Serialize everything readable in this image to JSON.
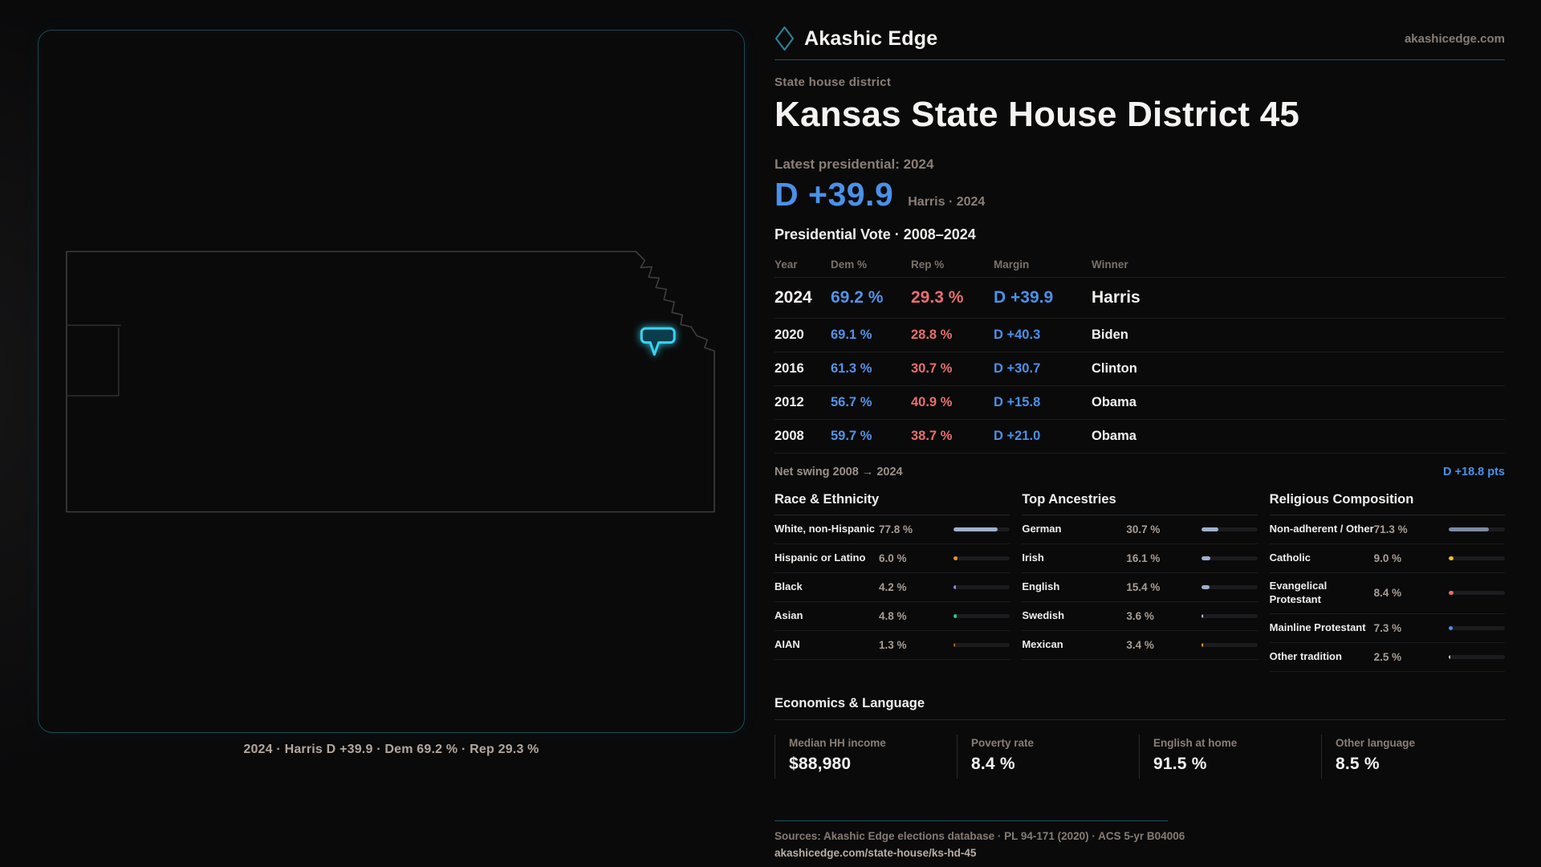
{
  "brand": {
    "name": "Akashic Edge",
    "site": "akashicedge.com"
  },
  "page": {
    "eyebrow": "State house district",
    "title": "Kansas State House District 45"
  },
  "latest": {
    "label": "Latest presidential: 2024",
    "margin": "D +39.9",
    "context": "Harris · 2024"
  },
  "vote_table": {
    "title": "Presidential Vote · 2008–2024",
    "columns": [
      "Year",
      "Dem %",
      "Rep %",
      "Margin",
      "Winner"
    ],
    "rows": [
      {
        "year": "2024",
        "dem": "69.2 %",
        "rep": "29.3 %",
        "margin": "D +39.9",
        "winner": "Harris"
      },
      {
        "year": "2020",
        "dem": "69.1 %",
        "rep": "28.8 %",
        "margin": "D +40.3",
        "winner": "Biden"
      },
      {
        "year": "2016",
        "dem": "61.3 %",
        "rep": "30.7 %",
        "margin": "D +30.7",
        "winner": "Clinton"
      },
      {
        "year": "2012",
        "dem": "56.7 %",
        "rep": "40.9 %",
        "margin": "D +15.8",
        "winner": "Obama"
      },
      {
        "year": "2008",
        "dem": "59.7 %",
        "rep": "38.7 %",
        "margin": "D +21.0",
        "winner": "Obama"
      }
    ]
  },
  "net_swing": {
    "label": "Net swing 2008 → 2024",
    "value": "D +18.8 pts"
  },
  "sections": [
    {
      "title": "Race & Ethnicity",
      "rows": [
        {
          "label": "White, non-Hispanic",
          "value": "77.8 %",
          "pct": 77.8,
          "color": "#9db1cc"
        },
        {
          "label": "Hispanic or Latino",
          "value": "6.0 %",
          "pct": 6.0,
          "color": "#e8962e"
        },
        {
          "label": "Black",
          "value": "4.2 %",
          "pct": 4.2,
          "color": "#9c85e8"
        },
        {
          "label": "Asian",
          "value": "4.8 %",
          "pct": 4.8,
          "color": "#2ec48e"
        },
        {
          "label": "AIAN",
          "value": "1.3 %",
          "pct": 1.3,
          "color": "#b26a1e"
        }
      ]
    },
    {
      "title": "Top Ancestries",
      "rows": [
        {
          "label": "German",
          "value": "30.7 %",
          "pct": 30.7,
          "color": "#9db1cc"
        },
        {
          "label": "Irish",
          "value": "16.1 %",
          "pct": 16.1,
          "color": "#9db1cc"
        },
        {
          "label": "English",
          "value": "15.4 %",
          "pct": 15.4,
          "color": "#9db1cc"
        },
        {
          "label": "Swedish",
          "value": "3.6 %",
          "pct": 3.6,
          "color": "#b8c3d4"
        },
        {
          "label": "Mexican",
          "value": "3.4 %",
          "pct": 3.4,
          "color": "#e8a22e"
        }
      ]
    },
    {
      "title": "Religious Composition",
      "rows": [
        {
          "label": "Non-adherent / Other",
          "value": "71.3 %",
          "pct": 71.3,
          "color": "#7c8aa3"
        },
        {
          "label": "Catholic",
          "value": "9.0 %",
          "pct": 9.0,
          "color": "#e8c230"
        },
        {
          "label": "Evangelical Protestant",
          "value": "8.4 %",
          "pct": 8.4,
          "color": "#e56d6d"
        },
        {
          "label": "Mainline Protestant",
          "value": "7.3 %",
          "pct": 7.3,
          "color": "#4e94e8"
        },
        {
          "label": "Other tradition",
          "value": "2.5 %",
          "pct": 2.5,
          "color": "#c7c7cc"
        }
      ]
    }
  ],
  "economics": {
    "title": "Economics & Language",
    "stats": [
      {
        "label": "Median HH income",
        "value": "$88,980"
      },
      {
        "label": "Poverty rate",
        "value": "8.4 %"
      },
      {
        "label": "English at home",
        "value": "91.5 %"
      },
      {
        "label": "Other language",
        "value": "8.5 %"
      }
    ]
  },
  "map": {
    "caption": "2024 · Harris D +39.9 · Dem 69.2 % · Rep 29.3 %"
  },
  "footer": {
    "sources": "Sources: Akashic Edge elections database · PL 94-171 (2020) · ACS 5-yr B04006",
    "permalink": "akashicedge.com/state-house/ks-hd-45"
  },
  "colors": {
    "accent_blue": "#4a91e8",
    "accent_red": "#e96e6e",
    "accent_cyan": "#38d2f0",
    "panel_border": "#1c4a56"
  },
  "chart_data": {
    "type": "table",
    "title": "Presidential Vote · 2008–2024",
    "categories": [
      "2024",
      "2020",
      "2016",
      "2012",
      "2008"
    ],
    "series": [
      {
        "name": "Dem %",
        "values": [
          69.2,
          69.1,
          61.3,
          56.7,
          59.7
        ]
      },
      {
        "name": "Rep %",
        "values": [
          29.3,
          28.8,
          30.7,
          40.9,
          38.7
        ]
      },
      {
        "name": "Margin D+",
        "values": [
          39.9,
          40.3,
          30.7,
          15.8,
          21.0
        ]
      },
      {
        "name": "Winner",
        "values": [
          "Harris",
          "Biden",
          "Clinton",
          "Obama",
          "Obama"
        ]
      }
    ]
  }
}
